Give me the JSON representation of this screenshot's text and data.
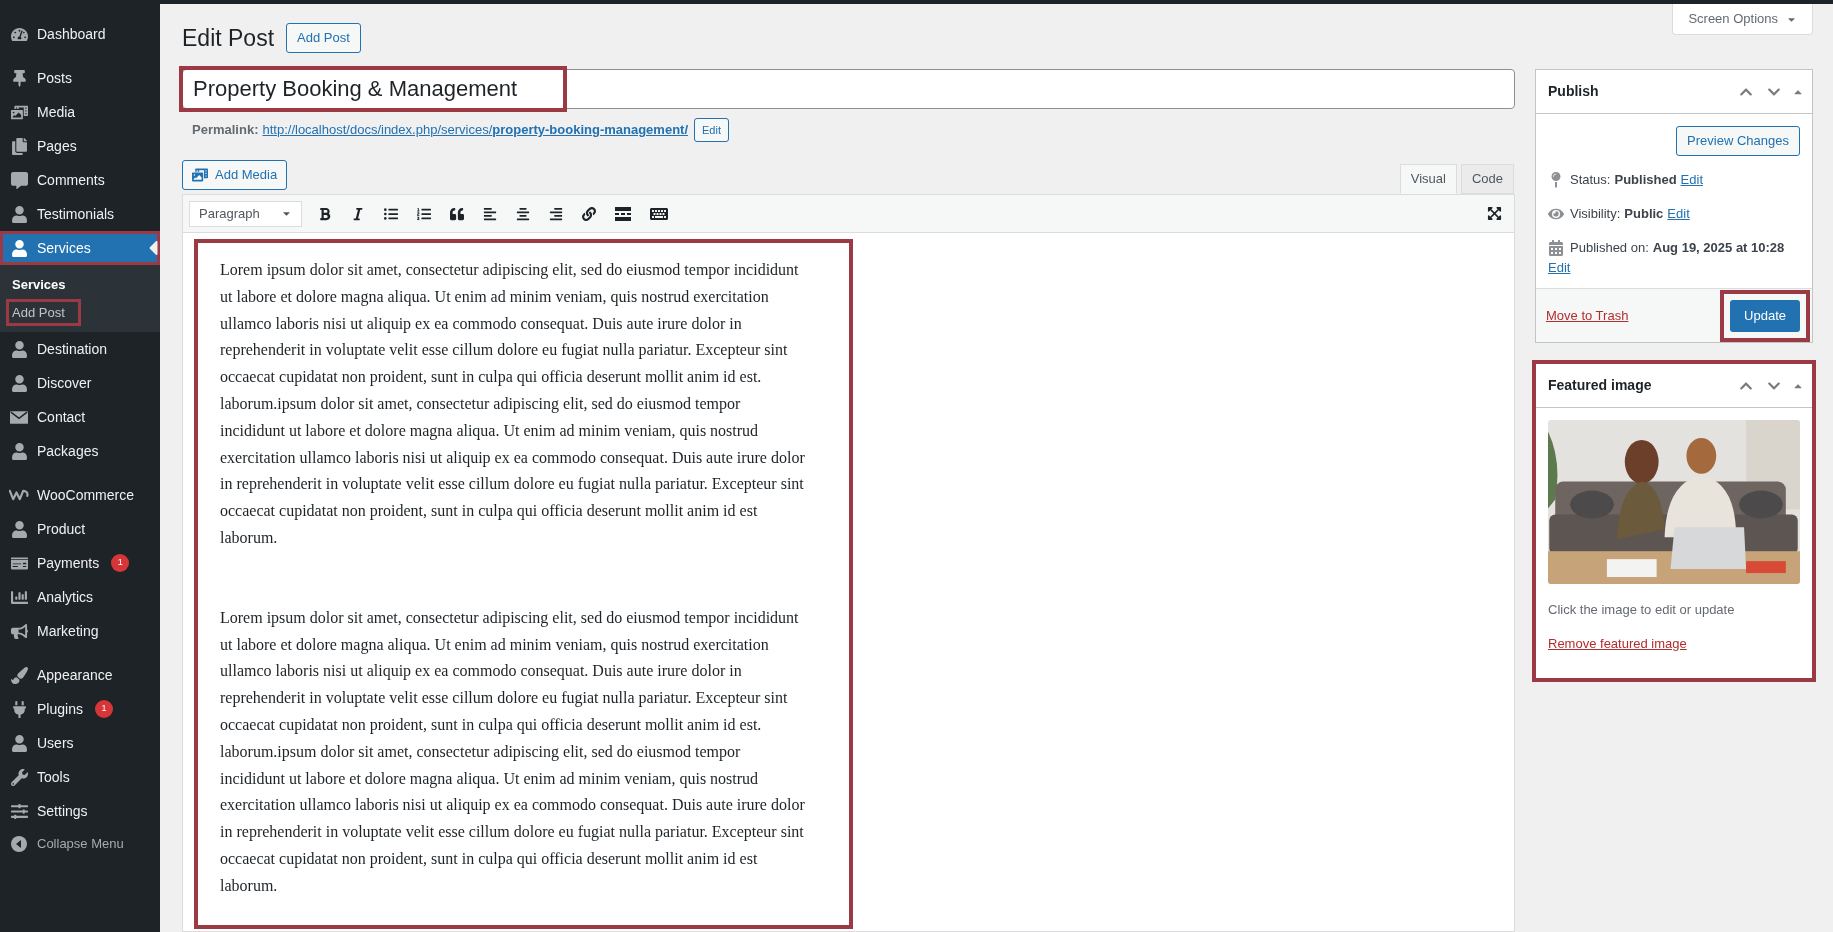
{
  "menu_groups": [
    [
      {
        "label": "Dashboard",
        "selected": false,
        "highlighted": false
      }
    ],
    [
      {
        "label": "Posts",
        "selected": false,
        "highlighted": false
      },
      {
        "label": "Media",
        "selected": false,
        "highlighted": false
      },
      {
        "label": "Pages",
        "selected": false,
        "highlighted": false
      },
      {
        "label": "Comments",
        "selected": false,
        "highlighted": false
      },
      {
        "label": "Testimonials",
        "selected": false,
        "highlighted": false
      },
      {
        "label": "Services",
        "selected": true,
        "highlighted": true,
        "children": [
          {
            "label": "Services",
            "selected": true,
            "highlighted": false
          },
          {
            "label": "Add Post",
            "selected": false,
            "highlighted": true
          }
        ]
      },
      {
        "label": "Destination",
        "selected": false,
        "highlighted": false
      },
      {
        "label": "Discover",
        "selected": false,
        "highlighted": false
      },
      {
        "label": "Contact",
        "selected": false,
        "highlighted": false
      },
      {
        "label": "Packages",
        "selected": false,
        "highlighted": false
      }
    ],
    [
      {
        "label": "WooCommerce",
        "selected": false,
        "highlighted": false
      },
      {
        "label": "Product",
        "selected": false,
        "highlighted": false
      },
      {
        "label": "Payments",
        "selected": false,
        "highlighted": false,
        "badge": "1"
      },
      {
        "label": "Analytics",
        "selected": false,
        "highlighted": false
      },
      {
        "label": "Marketing",
        "selected": false,
        "highlighted": false
      }
    ],
    [
      {
        "label": "Appearance",
        "selected": false,
        "highlighted": false
      },
      {
        "label": "Plugins",
        "selected": false,
        "highlighted": false,
        "badge": "1"
      },
      {
        "label": "Users",
        "selected": false,
        "highlighted": false
      },
      {
        "label": "Tools",
        "selected": false,
        "highlighted": false
      },
      {
        "label": "Settings",
        "selected": false,
        "highlighted": false
      }
    ]
  ],
  "collapse_label": "Collapse Menu",
  "heading": "Edit Post",
  "add_new": "Add Post",
  "screen_options": "Screen Options",
  "title": {
    "value": "Property Booking & Management",
    "highlighted": true
  },
  "permalink": {
    "label": "Permalink:",
    "base": "http://localhost/docs/index.php/services/",
    "slug": "property-booking-management/",
    "edit": "Edit"
  },
  "add_media": "Add Media",
  "editor_tabs": [
    {
      "label": "Visual",
      "selected": true
    },
    {
      "label": "Code",
      "selected": false
    }
  ],
  "format_select": "Paragraph",
  "content": {
    "highlighted": true,
    "paragraphs": [
      "Lorem ipsum dolor sit amet, consectetur adipiscing elit, sed do eiusmod tempor incididunt ut labore et dolore magna aliqua. Ut enim ad minim veniam, quis nostrud exercitation ullamco laboris nisi ut aliquip ex ea commodo consequat. Duis aute irure dolor in reprehenderit in voluptate velit esse cillum dolore eu fugiat nulla pariatur. Excepteur sint occaecat cupidatat non proident, sunt in culpa qui officia deserunt mollit anim id est. laborum.ipsum dolor sit amet, consectetur adipiscing elit, sed do eiusmod tempor incididunt ut labore et dolore magna aliqua. Ut enim ad minim veniam, quis nostrud exercitation ullamco laboris nisi ut aliquip ex ea commodo consequat. Duis aute irure dolor in reprehenderit in voluptate velit esse cillum dolore eu fugiat nulla pariatur. Excepteur sint occaecat cupidatat non proident, sunt in culpa qui officia deserunt mollit anim id est laborum.",
      "Lorem ipsum dolor sit amet, consectetur adipiscing elit, sed do eiusmod tempor incididunt ut labore et dolore magna aliqua. Ut enim ad minim veniam, quis nostrud exercitation ullamco laboris nisi ut aliquip ex ea commodo consequat. Duis aute irure dolor in reprehenderit in voluptate velit esse cillum dolore eu fugiat nulla pariatur. Excepteur sint occaecat cupidatat non proident, sunt in culpa qui officia deserunt mollit anim id est. laborum.ipsum dolor sit amet, consectetur adipiscing elit, sed do eiusmod tempor incididunt ut labore et dolore magna aliqua. Ut enim ad minim veniam, quis nostrud exercitation ullamco laboris nisi ut aliquip ex ea commodo consequat. Duis aute irure dolor in reprehenderit in voluptate velit esse cillum dolore eu fugiat nulla pariatur. Excepteur sint occaecat cupidatat non proident, sunt in culpa qui officia deserunt mollit anim id est laborum."
    ]
  },
  "publish": {
    "title": "Publish",
    "preview": "Preview Changes",
    "rows": [
      {
        "label": "Status:",
        "value": "Published",
        "edit": "Edit"
      },
      {
        "label": "Visibility:",
        "value": "Public",
        "edit": "Edit"
      },
      {
        "label": "Published on:",
        "value": "Aug 19, 2025 at 10:28",
        "edit": "Edit"
      }
    ],
    "trash": "Move to Trash",
    "update": {
      "label": "Update",
      "highlighted": true
    }
  },
  "featured": {
    "title": "Featured image",
    "highlighted": true,
    "hint": "Click the image to edit or update",
    "remove": "Remove featured image"
  }
}
